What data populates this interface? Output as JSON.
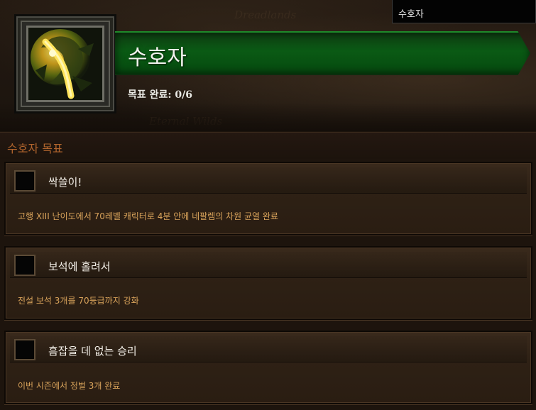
{
  "window": {
    "search_value": "수호자"
  },
  "background_map": {
    "labels": [
      "Dreadlands",
      "Eternal Wilds"
    ]
  },
  "achievement_set": {
    "title": "수호자",
    "progress_label": "목표 완료: 0/6",
    "icon": "guardian-emblem-icon"
  },
  "section": {
    "title": "수호자 목표"
  },
  "objectives": [
    {
      "title": "싹쓸이!",
      "description": "고행 XIII 난이도에서 70레벨 캐릭터로 4분 안에 네팔렘의 차원 균열 완료",
      "completed": false
    },
    {
      "title": "보석에 홀려서",
      "description": "전설 보석 3개를 70등급까지 강화",
      "completed": false
    },
    {
      "title": "흠잡을 데 없는 승리",
      "description": "이번 시즌에서 정벌 3개 완료",
      "completed": false
    }
  ],
  "colors": {
    "banner_green": "#0a5a14",
    "section_title": "#b2652d",
    "description_text": "#d9a35b",
    "card_background": "#2e2115"
  }
}
